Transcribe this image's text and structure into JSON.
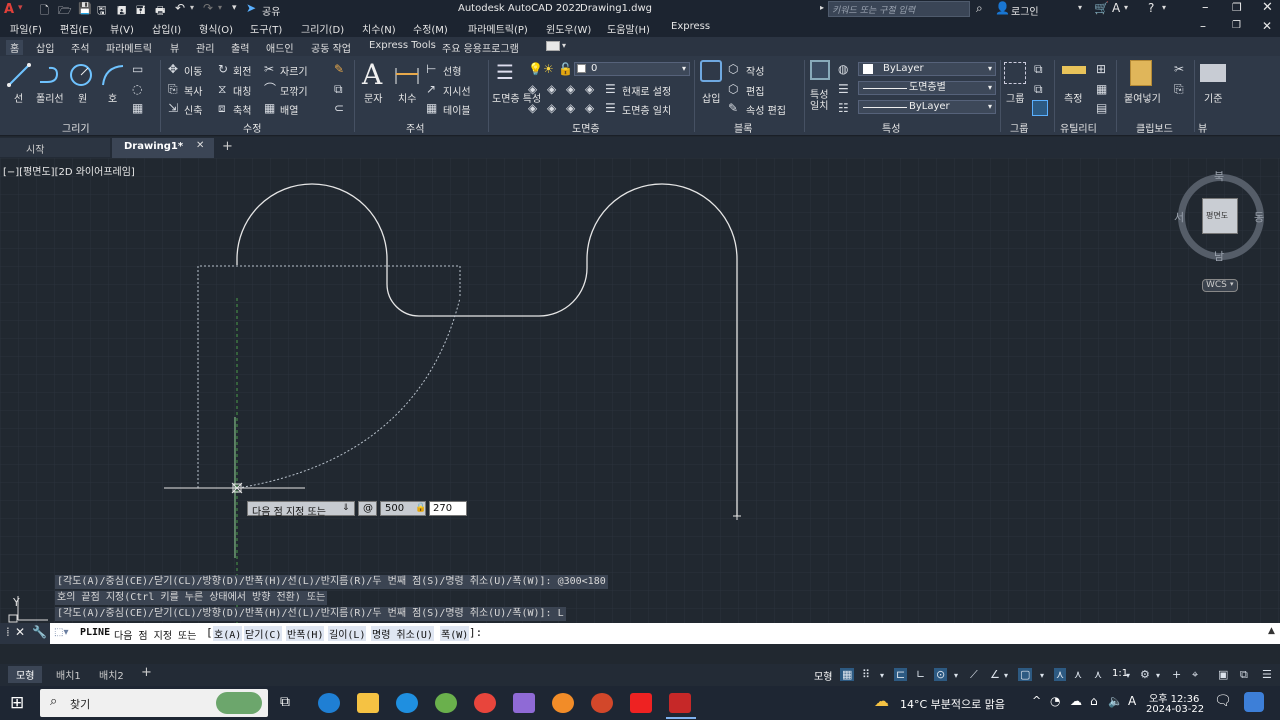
{
  "titlebar": {
    "app_title": "Autodesk AutoCAD 2022",
    "file_title": "Drawing1.dwg",
    "share": "공유",
    "search_placeholder": "키워드 또는 구절 입력",
    "login": "로그인"
  },
  "menu": [
    "파일(F)",
    "편집(E)",
    "뷰(V)",
    "삽입(I)",
    "형식(O)",
    "도구(T)",
    "그리기(D)",
    "치수(N)",
    "수정(M)",
    "파라메트릭(P)",
    "윈도우(W)",
    "도움말(H)",
    "Express"
  ],
  "ribbon_tabs": [
    "홈",
    "삽입",
    "주석",
    "파라메트릭",
    "뷰",
    "관리",
    "출력",
    "애드인",
    "공동 작업",
    "Express Tools",
    "주요 응용프로그램"
  ],
  "ribbon": {
    "draw": {
      "line": "선",
      "polyline": "폴리선",
      "circle": "원",
      "arc": "호",
      "title": "그리기"
    },
    "modify": {
      "move": "이동",
      "rotate": "회전",
      "trim": "자르기",
      "copy": "복사",
      "mirror": "대칭",
      "fillet": "모깎기",
      "stretch": "신축",
      "scale": "축척",
      "array": "배열",
      "title": "수정"
    },
    "annotation": {
      "text": "문자",
      "dimension": "치수",
      "linear": "선형",
      "leader": "지시선",
      "table": "테이블",
      "title": "주석"
    },
    "layers": {
      "layer_props": "도면층 특성",
      "current_layer": "0",
      "make_current": "현재로 설정",
      "match_layer": "도면층 일치",
      "title": "도면층"
    },
    "block": {
      "insert": "삽입",
      "create": "작성",
      "edit": "편집",
      "attr_edit": "속성 편집",
      "title": "블록"
    },
    "properties": {
      "match": "특성 일치",
      "color": "ByLayer",
      "linetype": "도면층별",
      "lineweight": "ByLayer",
      "title": "특성"
    },
    "groups": {
      "group": "그룹",
      "title": "그룹"
    },
    "utilities": {
      "measure": "측정",
      "title": "유틸리티"
    },
    "clipboard": {
      "paste": "붙여넣기",
      "title": "클립보드"
    },
    "view": {
      "base": "기준",
      "title": "뷰"
    }
  },
  "file_tabs": {
    "start": "시작",
    "drawing": "Drawing1*"
  },
  "viewport_label": "[−][평면도][2D 와이어프레임]",
  "viewcube": {
    "north": "북",
    "south": "남",
    "east": "동",
    "west": "서",
    "face": "평면도",
    "wcs": "WCS"
  },
  "dynamic_input": {
    "prompt": "다음 점 지정 또는",
    "at": "@",
    "value1": "500",
    "value2": "270"
  },
  "history": [
    "[각도(A)/중심(CE)/닫기(CL)/방향(D)/반폭(H)/선(L)/반지름(R)/두 번째 점(S)/명령 취소(U)/폭(W)]: @300<180",
    "호의 끝점 지정(Ctrl 키를 누른 상태에서 방향 전환) 또는",
    "[각도(A)/중심(CE)/닫기(CL)/방향(D)/반폭(H)/선(L)/반지름(R)/두 번째 점(S)/명령 취소(U)/폭(W)]: L"
  ],
  "command": {
    "name": "PLINE",
    "prompt": "다음 점 지정 또는",
    "options": [
      "호(A)",
      "닫기(C)",
      "반폭(H)",
      "길이(L)",
      "명령 취소(U)",
      "폭(W)"
    ]
  },
  "layout_tabs": [
    "모형",
    "배치1",
    "배치2"
  ],
  "status": {
    "model": "모형",
    "scale": "1:1"
  },
  "taskbar": {
    "search": "찾기",
    "weather": "14°C 부분적으로 맑음",
    "ime": "A",
    "ampm_time": "오후 12:36",
    "date": "2024-03-22"
  }
}
